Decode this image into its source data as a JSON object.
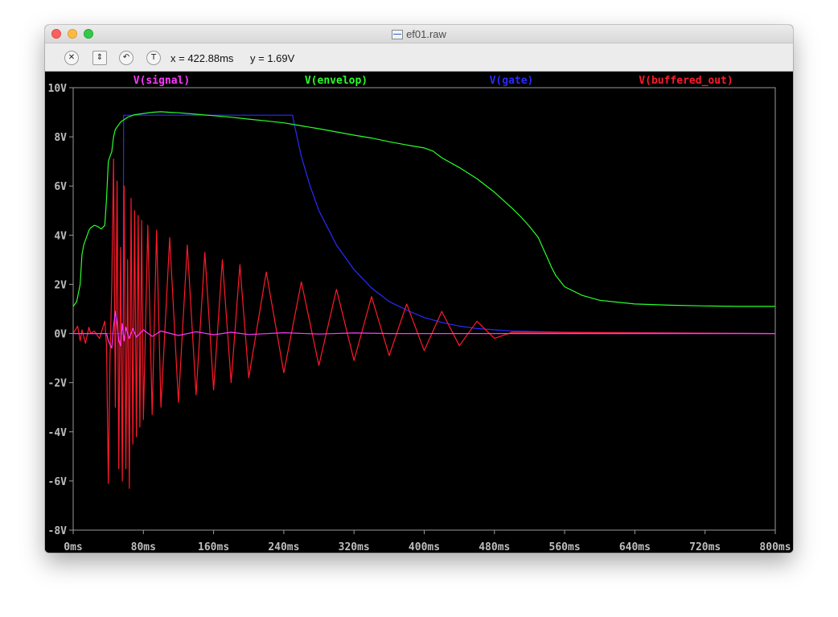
{
  "window": {
    "title": "ef01.raw"
  },
  "toolbar": {
    "icons": [
      "zoom-cancel-icon",
      "autorange-icon",
      "undo-zoom-icon",
      "ruler-cursor-icon"
    ],
    "cursor_x": "x = 422.88ms",
    "cursor_y": "y = 1.69V"
  },
  "chart_data": {
    "type": "line",
    "title": "",
    "xlabel": "",
    "ylabel": "",
    "xlim": [
      0,
      800
    ],
    "ylim": [
      -8,
      10
    ],
    "x_ticks": [
      "0ms",
      "80ms",
      "160ms",
      "240ms",
      "320ms",
      "400ms",
      "480ms",
      "560ms",
      "640ms",
      "720ms",
      "800ms"
    ],
    "y_ticks": [
      "10V",
      "8V",
      "6V",
      "4V",
      "2V",
      "0V",
      "-2V",
      "-4V",
      "-6V",
      "-8V"
    ],
    "grid": false,
    "legend": "top",
    "series": [
      {
        "name": "V(signal)",
        "color": "#ff38ff",
        "x": [
          0,
          10,
          20,
          30,
          38,
          40,
          44,
          46,
          48,
          50,
          52,
          54,
          56,
          58,
          60,
          64,
          68,
          72,
          80,
          90,
          100,
          120,
          140,
          160,
          180,
          200,
          240,
          280,
          320,
          360,
          400,
          440,
          480,
          600,
          800
        ],
        "y": [
          0,
          0,
          0,
          0,
          0,
          -0.3,
          -0.6,
          0.3,
          0.9,
          0.4,
          -0.3,
          -0.5,
          0.4,
          -0.3,
          0.25,
          -0.2,
          0.2,
          -0.15,
          0.15,
          -0.12,
          0.1,
          -0.08,
          0.07,
          -0.05,
          0.05,
          -0.04,
          0.03,
          -0.02,
          0.02,
          0,
          0,
          0,
          0,
          0,
          0
        ]
      },
      {
        "name": "V(envelop)",
        "color": "#2aff2a",
        "x": [
          0,
          4,
          8,
          10,
          12,
          14,
          16,
          18,
          20,
          24,
          28,
          32,
          36,
          38,
          40,
          42,
          44,
          46,
          48,
          50,
          54,
          58,
          62,
          70,
          80,
          90,
          100,
          110,
          120,
          140,
          160,
          180,
          200,
          220,
          240,
          260,
          280,
          300,
          320,
          340,
          360,
          380,
          400,
          410,
          420,
          440,
          460,
          480,
          500,
          510,
          520,
          530,
          535,
          540,
          545,
          550,
          560,
          580,
          600,
          640,
          680,
          720,
          760,
          800
        ],
        "y": [
          1.1,
          1.3,
          2.0,
          3.2,
          3.6,
          3.8,
          4.0,
          4.2,
          4.3,
          4.4,
          4.35,
          4.25,
          4.4,
          5.5,
          7.0,
          7.2,
          7.4,
          8.0,
          8.3,
          8.4,
          8.6,
          8.7,
          8.8,
          8.9,
          8.95,
          9.0,
          9.02,
          9.0,
          8.98,
          8.92,
          8.86,
          8.8,
          8.72,
          8.65,
          8.57,
          8.45,
          8.33,
          8.2,
          8.07,
          7.95,
          7.8,
          7.67,
          7.55,
          7.42,
          7.15,
          6.75,
          6.3,
          5.75,
          5.1,
          4.75,
          4.35,
          3.9,
          3.5,
          3.1,
          2.7,
          2.35,
          1.9,
          1.55,
          1.35,
          1.2,
          1.15,
          1.12,
          1.1,
          1.1
        ]
      },
      {
        "name": "V(gate)",
        "color": "#2b2bff",
        "x": [
          0,
          10,
          20,
          30,
          40,
          50,
          57,
          57.5,
          60,
          80,
          100,
          150,
          200,
          250,
          252,
          260,
          270,
          280,
          300,
          320,
          340,
          360,
          380,
          400,
          420,
          440,
          460,
          480,
          500,
          560,
          800
        ],
        "y": [
          0,
          0,
          0,
          0,
          0,
          0,
          0,
          8.88,
          8.88,
          8.88,
          8.88,
          8.88,
          8.88,
          8.88,
          8.5,
          7.2,
          6.0,
          5.0,
          3.6,
          2.6,
          1.85,
          1.3,
          0.95,
          0.65,
          0.45,
          0.3,
          0.2,
          0.15,
          0.1,
          0.05,
          0
        ]
      },
      {
        "name": "V(buffered_out)",
        "color": "#ff1a2a",
        "x": [
          0,
          5,
          8,
          10,
          14,
          18,
          20,
          24,
          30,
          36,
          38,
          40,
          42,
          44,
          46,
          48,
          50,
          52,
          54,
          56,
          58,
          60,
          62,
          64,
          66,
          68,
          70,
          72,
          74,
          76,
          78,
          80,
          85,
          90,
          95,
          100,
          110,
          120,
          130,
          140,
          150,
          160,
          170,
          180,
          190,
          200,
          220,
          240,
          260,
          280,
          300,
          320,
          340,
          360,
          380,
          400,
          420,
          440,
          460,
          480,
          500,
          800
        ],
        "y": [
          0,
          0.3,
          -0.3,
          0.15,
          -0.4,
          0.25,
          0,
          0.1,
          -0.2,
          0.5,
          -0.5,
          -6.1,
          -1.0,
          2.0,
          7.1,
          -3.0,
          6.2,
          -5.5,
          3.5,
          -6.0,
          6.0,
          -5.5,
          3.0,
          -6.3,
          5.5,
          -4.5,
          5.0,
          -4.2,
          4.8,
          -3.8,
          4.6,
          -3.5,
          4.4,
          -3.3,
          4.2,
          -3.0,
          3.9,
          -2.8,
          3.6,
          -2.5,
          3.3,
          -2.3,
          3.0,
          -2.0,
          2.8,
          -1.8,
          2.5,
          -1.6,
          2.1,
          -1.3,
          1.8,
          -1.1,
          1.5,
          -0.9,
          1.2,
          -0.7,
          0.9,
          -0.5,
          0.5,
          -0.2,
          0.05,
          0
        ]
      }
    ]
  }
}
